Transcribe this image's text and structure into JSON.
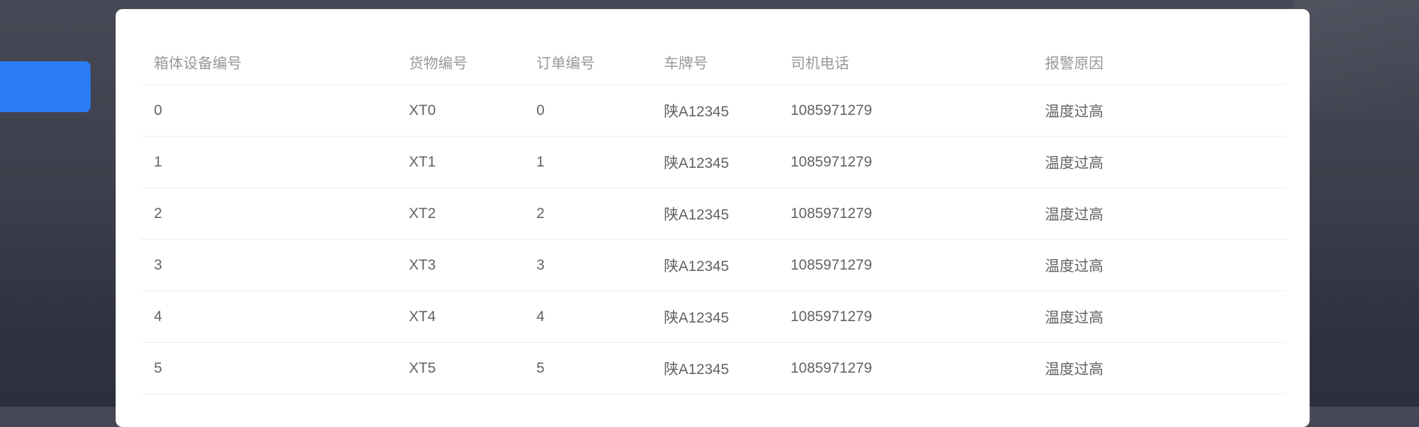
{
  "colors": {
    "accent": "#2c7cf6",
    "header_text": "#999999",
    "cell_text": "#606266"
  },
  "table": {
    "columns": [
      "箱体设备编号",
      "货物编号",
      "订单编号",
      "车牌号",
      "司机电话",
      "报警原因"
    ],
    "rows": [
      [
        "0",
        "XT0",
        "0",
        "陕A12345",
        "1085971279",
        "温度过高"
      ],
      [
        "1",
        "XT1",
        "1",
        "陕A12345",
        "1085971279",
        "温度过高"
      ],
      [
        "2",
        "XT2",
        "2",
        "陕A12345",
        "1085971279",
        "温度过高"
      ],
      [
        "3",
        "XT3",
        "3",
        "陕A12345",
        "1085971279",
        "温度过高"
      ],
      [
        "4",
        "XT4",
        "4",
        "陕A12345",
        "1085971279",
        "温度过高"
      ],
      [
        "5",
        "XT5",
        "5",
        "陕A12345",
        "1085971279",
        "温度过高"
      ]
    ]
  }
}
